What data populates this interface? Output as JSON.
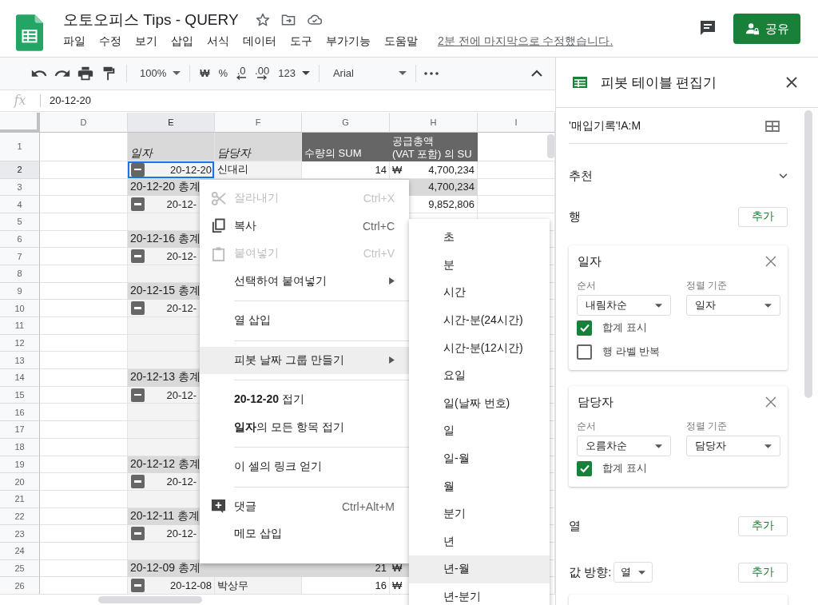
{
  "document": {
    "title": "오토오피스 Tips - QUERY",
    "last_edit": "2분 전에 마지막으로 수정했습니다.",
    "share_label": "공유"
  },
  "menu": [
    "파일",
    "수정",
    "보기",
    "삽입",
    "서식",
    "데이터",
    "도구",
    "부가기능",
    "도움말"
  ],
  "toolbar": {
    "zoom": "100%",
    "currency": "₩",
    "percent": "%",
    "decrease_decimal": ".0",
    "increase_decimal": ".00",
    "number_format": "123",
    "font": "Arial"
  },
  "formula_bar": {
    "label": "fx",
    "value": "20-12-20"
  },
  "sheet": {
    "columns": [
      {
        "label": "D",
        "selected": false
      },
      {
        "label": "E",
        "selected": true
      },
      {
        "label": "F",
        "selected": false
      },
      {
        "label": "G",
        "selected": false
      },
      {
        "label": "H",
        "selected": false
      },
      {
        "label": "I",
        "selected": false
      }
    ],
    "rows": [
      {
        "number": "1",
        "selected": false,
        "kind": "header",
        "e": "일자",
        "f": "담당자",
        "g": "수량의 SUM",
        "h_lines": [
          "공급총액",
          "(VAT 포함) 의 SU"
        ]
      },
      {
        "number": "2",
        "selected": true,
        "kind": "data",
        "e": "20-12-20",
        "f": "신대리",
        "g": "14",
        "h_currency": "₩",
        "h": "4,700,234"
      },
      {
        "number": "3",
        "selected": false,
        "kind": "subtotal",
        "e": "20-12-20 총계",
        "h": "4,700,234"
      },
      {
        "number": "4",
        "selected": false,
        "kind": "data",
        "e": "20-12-",
        "h": "9,852,806"
      },
      {
        "number": "5",
        "selected": false,
        "kind": "blank"
      },
      {
        "number": "6",
        "selected": false,
        "kind": "subtotal",
        "e": "20-12-16 총계"
      },
      {
        "number": "7",
        "selected": false,
        "kind": "data",
        "e": "20-12-"
      },
      {
        "number": "8",
        "selected": false,
        "kind": "blank"
      },
      {
        "number": "9",
        "selected": false,
        "kind": "subtotal",
        "e": "20-12-15 총계"
      },
      {
        "number": "10",
        "selected": false,
        "kind": "data",
        "e": "20-12-"
      },
      {
        "number": "11",
        "selected": false,
        "kind": "blank"
      },
      {
        "number": "12",
        "selected": false,
        "kind": "blank"
      },
      {
        "number": "13",
        "selected": false,
        "kind": "blank"
      },
      {
        "number": "14",
        "selected": false,
        "kind": "subtotal",
        "e": "20-12-13 총계"
      },
      {
        "number": "15",
        "selected": false,
        "kind": "data",
        "e": "20-12-"
      },
      {
        "number": "16",
        "selected": false,
        "kind": "blank"
      },
      {
        "number": "17",
        "selected": false,
        "kind": "blank"
      },
      {
        "number": "18",
        "selected": false,
        "kind": "blank"
      },
      {
        "number": "19",
        "selected": false,
        "kind": "subtotal",
        "e": "20-12-12 총계"
      },
      {
        "number": "20",
        "selected": false,
        "kind": "data",
        "e": "20-12-"
      },
      {
        "number": "21",
        "selected": false,
        "kind": "blank"
      },
      {
        "number": "22",
        "selected": false,
        "kind": "subtotal",
        "e": "20-12-11 총계"
      },
      {
        "number": "23",
        "selected": false,
        "kind": "data",
        "e": "20-12-"
      },
      {
        "number": "24",
        "selected": false,
        "kind": "blank"
      },
      {
        "number": "25",
        "selected": false,
        "kind": "subtotal",
        "e": "20-12-09 총계",
        "g": "21",
        "h_currency": "₩"
      },
      {
        "number": "26",
        "selected": false,
        "kind": "data",
        "e": "20-12-08",
        "f": "박상무",
        "g": "16",
        "h_currency": "₩"
      }
    ]
  },
  "context_menu": {
    "groups": [
      {
        "items": [
          {
            "label": "잘라내기",
            "shortcut": "Ctrl+X",
            "disabled": true,
            "selected": false,
            "has_submenu": false
          },
          {
            "label": "복사",
            "shortcut": "Ctrl+C",
            "disabled": false,
            "selected": false,
            "has_submenu": false
          },
          {
            "label": "붙여넣기",
            "shortcut": "Ctrl+V",
            "disabled": true,
            "selected": false,
            "has_submenu": false
          },
          {
            "label": "선택하여 붙여넣기",
            "disabled": false,
            "selected": false,
            "has_submenu": true
          }
        ]
      },
      {
        "items": [
          {
            "label": "열 삽입",
            "disabled": false,
            "selected": false,
            "has_submenu": false
          }
        ]
      },
      {
        "items": [
          {
            "label": "피봇 날짜 그룹 만들기",
            "disabled": false,
            "selected": true,
            "has_submenu": true
          }
        ]
      },
      {
        "items": [
          {
            "label": "**20-12-20** 접기",
            "disabled": false,
            "selected": false,
            "has_submenu": false
          },
          {
            "label": "**일자**의 모든 항목 접기",
            "disabled": false,
            "selected": false,
            "has_submenu": false
          }
        ]
      },
      {
        "items": [
          {
            "label": "이 셀의 링크 얻기",
            "disabled": false,
            "selected": false,
            "has_submenu": false
          }
        ]
      },
      {
        "items": [
          {
            "label": "댓글",
            "shortcut": "Ctrl+Alt+M",
            "disabled": false,
            "selected": false,
            "has_submenu": false
          },
          {
            "label": "메모 삽입",
            "disabled": false,
            "selected": false,
            "has_submenu": false
          }
        ]
      }
    ]
  },
  "submenu": {
    "items": [
      {
        "label": "초",
        "selected": false
      },
      {
        "label": "분",
        "selected": false
      },
      {
        "label": "시간",
        "selected": false
      },
      {
        "label": "시간-분(24시간)",
        "selected": false
      },
      {
        "label": "시간-분(12시간)",
        "selected": false
      },
      {
        "label": "요일",
        "selected": false
      },
      {
        "label": "일(날짜 번호)",
        "selected": false
      },
      {
        "label": "일",
        "selected": false
      },
      {
        "label": "일-월",
        "selected": false
      },
      {
        "label": "월",
        "selected": false
      },
      {
        "label": "분기",
        "selected": false
      },
      {
        "label": "년",
        "selected": false
      },
      {
        "label": "년-월",
        "selected": true
      },
      {
        "label": "년-분기",
        "selected": false
      }
    ]
  },
  "panel": {
    "title": "피봇 테이블 편집기",
    "range": "'매입기록'!A:M",
    "suggest": "추천",
    "rows_section": {
      "label": "행",
      "add": "추가",
      "cards": [
        {
          "title": "일자",
          "order_label": "순서",
          "order": "내림차순",
          "sort_label": "정렬 기준",
          "sort": "일자",
          "options": [
            {
              "label": "합계 표시",
              "checked": true
            },
            {
              "label": "행 라벨 반복",
              "checked": false
            }
          ]
        },
        {
          "title": "담당자",
          "order_label": "순서",
          "order": "오름차순",
          "sort_label": "정렬 기준",
          "sort": "담당자",
          "options": [
            {
              "label": "합계 표시",
              "checked": true
            }
          ]
        }
      ]
    },
    "columns_section": {
      "label": "열",
      "add": "추가"
    },
    "values_section": {
      "label": "값 방향:",
      "direction": "열",
      "add": "추가"
    }
  }
}
